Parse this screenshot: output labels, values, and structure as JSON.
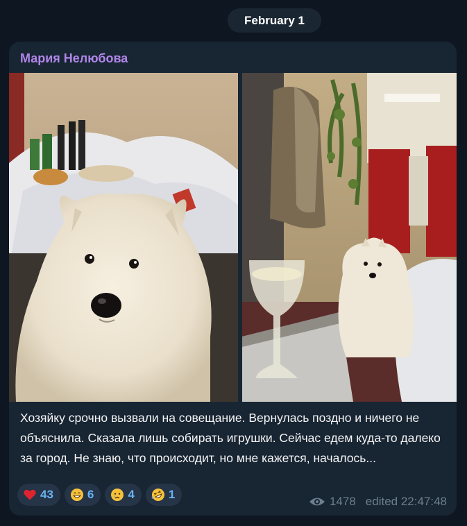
{
  "date_label": "February 1",
  "message": {
    "sender": "Мария Нелюбова",
    "sender_color": "#b086e8",
    "photos": [
      {
        "subject": "samoyed-closeup-train-berth"
      },
      {
        "subject": "samoyed-in-train-compartment-with-wine-glass"
      }
    ],
    "text": "Хозяйку срочно вызвали на совещание. Вернулась поздно и ничего не объяснила. Сказала лишь собирать игрушки. Сейчас едем куда-то далеко за город. Не знаю, что происходит, но мне кажется, началось...",
    "reactions": [
      {
        "icon": "red-heart-icon",
        "count": "43"
      },
      {
        "icon": "grinning-face-icon",
        "count": "6"
      },
      {
        "icon": "crying-face-icon",
        "count": "4"
      },
      {
        "icon": "rolling-laughing-face-icon",
        "count": "1"
      }
    ],
    "views": "1478",
    "edited": "edited 22:47:48"
  },
  "colors": {
    "background": "#0e1621",
    "bubble": "#182533",
    "reaction_bg": "#253447",
    "reaction_count": "#6ab3f3",
    "meta": "#6d7f8f"
  }
}
